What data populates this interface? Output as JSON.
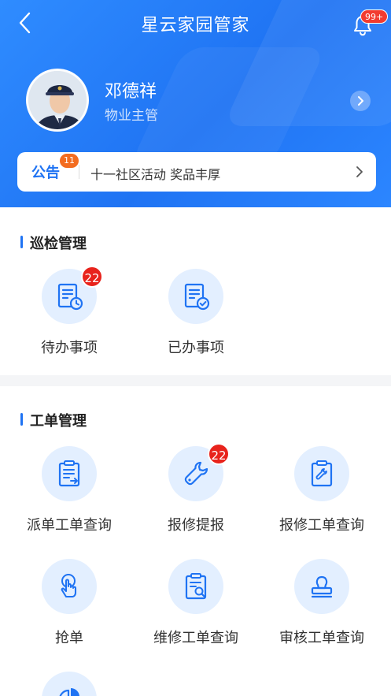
{
  "header": {
    "title": "星云家园管家",
    "notifications_badge": "99+"
  },
  "user": {
    "name": "邓德祥",
    "role": "物业主管"
  },
  "notice": {
    "label": "公告",
    "badge": "11",
    "text": "十一社区活动 奖品丰厚"
  },
  "patrol": {
    "title": "巡检管理",
    "items": [
      {
        "label": "待办事项",
        "badge": "22",
        "icon": "document-clock-icon"
      },
      {
        "label": "已办事项",
        "icon": "document-check-icon"
      }
    ]
  },
  "workorder": {
    "title": "工单管理",
    "items": [
      {
        "label": "派单工单查询",
        "icon": "clipboard-send-icon"
      },
      {
        "label": "报修提报",
        "badge": "22",
        "icon": "wrench-icon"
      },
      {
        "label": "报修工单查询",
        "icon": "clipboard-wrench-icon"
      },
      {
        "label": "抢单",
        "icon": "tap-hand-icon"
      },
      {
        "label": "维修工单查询",
        "icon": "clipboard-search-icon"
      },
      {
        "label": "审核工单查询",
        "icon": "stamp-icon"
      }
    ]
  },
  "colors": {
    "primary": "#1f73f3",
    "badge_red": "#e8231c",
    "icon_bg": "#e3efff"
  }
}
